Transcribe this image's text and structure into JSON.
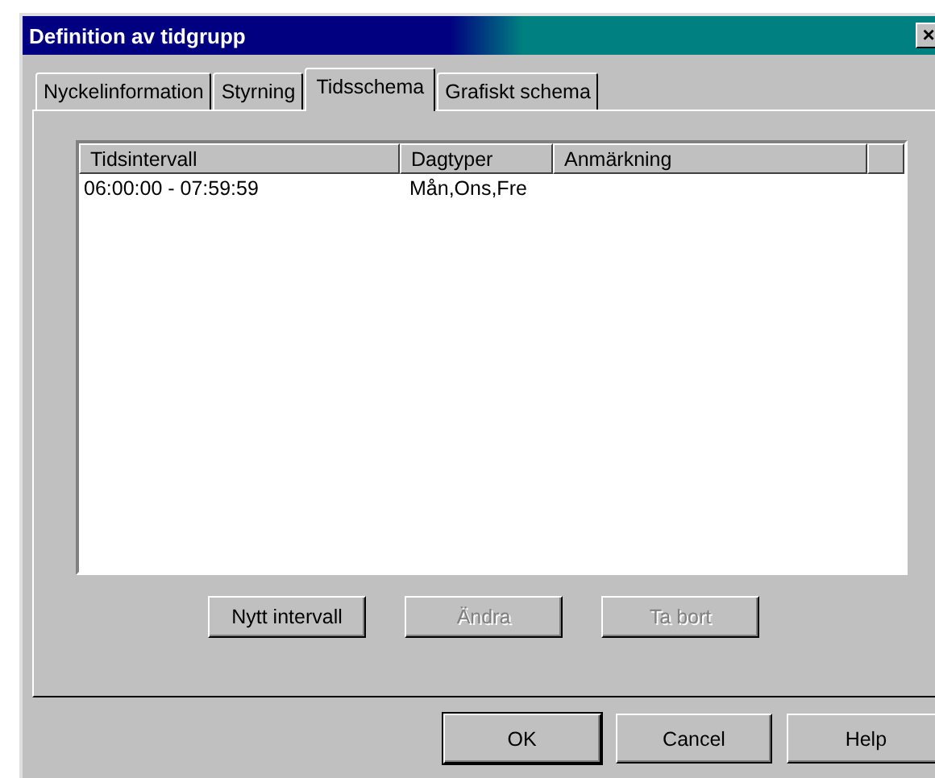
{
  "window": {
    "title": "Definition av tidgrupp",
    "close": "×"
  },
  "tabs": [
    {
      "label": "Nyckelinformation",
      "selected": false
    },
    {
      "label": "Styrning",
      "selected": false
    },
    {
      "label": "Tidsschema",
      "selected": true
    },
    {
      "label": "Grafiskt schema",
      "selected": false
    }
  ],
  "table": {
    "columns": [
      "Tidsintervall",
      "Dagtyper",
      "Anmärkning"
    ],
    "rows": [
      [
        "06:00:00 - 07:59:59",
        "Mån,Ons,Fre",
        ""
      ]
    ]
  },
  "actions": [
    {
      "label": "Nytt intervall",
      "disabled": false
    },
    {
      "label": "Ändra",
      "disabled": true
    },
    {
      "label": "Ta bort",
      "disabled": true
    }
  ],
  "buttons": [
    {
      "label": "OK",
      "default": true
    },
    {
      "label": "Cancel",
      "default": false
    },
    {
      "label": "Help",
      "default": false
    }
  ]
}
